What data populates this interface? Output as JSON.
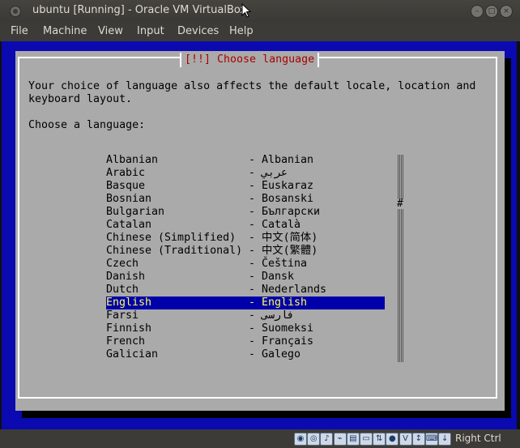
{
  "window": {
    "title": "ubuntu [Running] - Oracle VM VirtualBox"
  },
  "menu": {
    "items": [
      "File",
      "Machine",
      "View",
      "Input",
      "Devices",
      "Help"
    ]
  },
  "installer": {
    "dialog_title": "[!!] Choose language",
    "intro_line1": "Your choice of language also affects the default locale, location and",
    "intro_line2": "keyboard layout.",
    "prompt": "Choose a language:",
    "selected_language": "English",
    "languages": [
      {
        "name": "Albanian",
        "native": "Albanian"
      },
      {
        "name": "Arabic",
        "native": "عربي"
      },
      {
        "name": "Basque",
        "native": "Euskaraz"
      },
      {
        "name": "Bosnian",
        "native": "Bosanski"
      },
      {
        "name": "Bulgarian",
        "native": "Български"
      },
      {
        "name": "Catalan",
        "native": "Català"
      },
      {
        "name": "Chinese (Simplified)",
        "native": "中文(简体)"
      },
      {
        "name": "Chinese (Traditional)",
        "native": "中文(繁體)"
      },
      {
        "name": "Czech",
        "native": "Čeština"
      },
      {
        "name": "Danish",
        "native": "Dansk"
      },
      {
        "name": "Dutch",
        "native": "Nederlands"
      },
      {
        "name": "English",
        "native": "English"
      },
      {
        "name": "Farsi",
        "native": "فارسی"
      },
      {
        "name": "Finnish",
        "native": "Suomeksi"
      },
      {
        "name": "French",
        "native": "Français"
      },
      {
        "name": "Galician",
        "native": "Galego"
      }
    ],
    "separator": "-",
    "scroll_thumb": "#"
  },
  "statusbar": {
    "host_key": "Right Ctrl",
    "icons": [
      "hard-disk-icon",
      "optical-drive-icon",
      "audio-icon",
      "usb-icon",
      "shared-folders-icon",
      "display-icon",
      "network-icon",
      "video-capture-icon",
      "virtualization-icon",
      "mouse-integration-icon",
      "keyboard-icon",
      "host-key-icon"
    ]
  },
  "colors": {
    "vm_background": "#0a0ab0",
    "dialog_background": "#aaaaaa",
    "dialog_title": "#aa0000",
    "selection_background": "#0000aa",
    "selection_text": "#ffff55"
  }
}
